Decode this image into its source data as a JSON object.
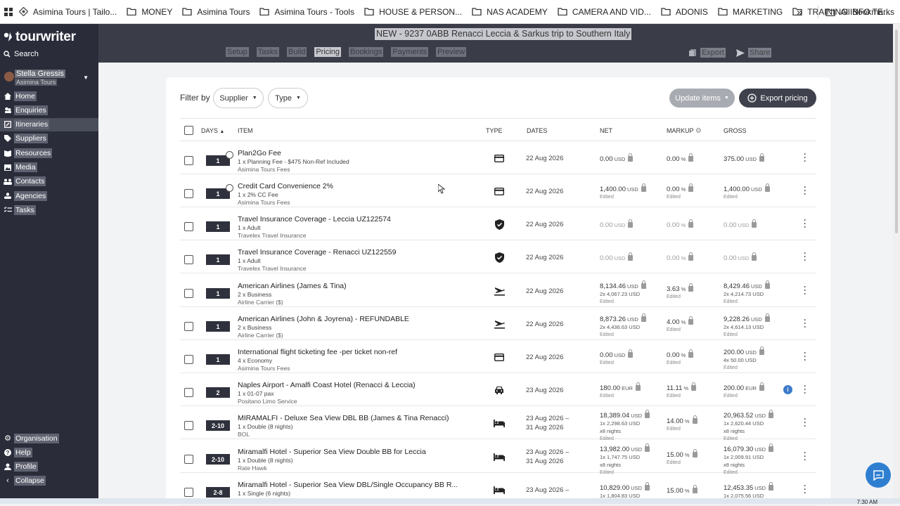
{
  "bookmarks": {
    "items": [
      "Asimina Tours | Tailo...",
      "MONEY",
      "Asimina Tours",
      "Asimina Tours - Tools",
      "HOUSE & PERSON...",
      "NAS ACADEMY",
      "CAMERA AND VID...",
      "ADONIS",
      "MARKETING",
      "TRAINING INFO TE..."
    ],
    "overflow": "»",
    "all": "All Bookmarks"
  },
  "sidebar": {
    "logo": "tourwriter",
    "search": "Search",
    "user_name": "Stella Gressis",
    "user_org": "Asimina Tours",
    "nav": [
      "Home",
      "Enquiries",
      "Itineraries",
      "Suppliers",
      "Resources",
      "Media",
      "Contacts",
      "Agencies",
      "Tasks"
    ],
    "bottom": [
      "Organisation",
      "Help",
      "Profile",
      "Collapse"
    ]
  },
  "header": {
    "title": "NEW - 9237 0ABB Renacci Leccia & Sarkus trip to Southern Italy",
    "tabs": [
      "Setup",
      "Tasks",
      "Build",
      "Pricing",
      "Bookings",
      "Payments",
      "Preview"
    ],
    "active_tab": "Pricing",
    "export": "Export",
    "share": "Share"
  },
  "toolbar": {
    "filter_by": "Filter by",
    "supplier": "Supplier",
    "type": "Type",
    "update_items": "Update items",
    "export_pricing": "Export pricing"
  },
  "columns": {
    "days": "DAYS",
    "item": "ITEM",
    "type": "TYPE",
    "dates": "DATES",
    "net": "NET",
    "markup": "MARKUP",
    "gross": "GROSS"
  },
  "rows": [
    {
      "days": "1",
      "title": "Plan2Go Fee",
      "sub": "1 x Planning Fee - $475 Non-Ref Included",
      "supplier": "Asimina Tours Fees",
      "type_icon": "card-icon",
      "date1": "22 Aug 2026",
      "date2": "",
      "net": "0.00",
      "net_cur": "USD",
      "net_line": "",
      "net_edited": "",
      "markup": "0.00",
      "markup_edited": "",
      "gross": "375.00",
      "gross_cur": "USD",
      "gross_line": "",
      "gross_edited": ""
    },
    {
      "days": "1",
      "title": "Credit Card Convenience 2%",
      "sub": "1 x 2% CC Fee",
      "supplier": "Asimina Tours Fees",
      "type_icon": "card-icon",
      "date1": "22 Aug 2026",
      "date2": "",
      "net": "1,400.00",
      "net_cur": "USD",
      "net_line": "",
      "net_edited": "Edited",
      "markup": "0.00",
      "markup_edited": "Edited",
      "gross": "1,400.00",
      "gross_cur": "USD",
      "gross_line": "",
      "gross_edited": "Edited"
    },
    {
      "days": "1",
      "title": "Travel Insurance Coverage - Leccia UZ122574",
      "sub": "1 x Adult",
      "supplier": "Travelex Travel Insurance",
      "type_icon": "shield-icon",
      "date1": "22 Aug 2026",
      "date2": "",
      "net": "0.00",
      "net_cur": "USD",
      "net_line": "",
      "net_edited": "",
      "markup": "0.00",
      "markup_edited": "",
      "gross": "0.00",
      "gross_cur": "USD",
      "gross_line": "",
      "gross_edited": ""
    },
    {
      "days": "1",
      "title": "Travel Insurance Coverage - Renacci UZ122559",
      "sub": "1 x Adult",
      "supplier": "Travelex Travel Insurance",
      "type_icon": "shield-icon",
      "date1": "22 Aug 2026",
      "date2": "",
      "net": "0.00",
      "net_cur": "USD",
      "net_line": "",
      "net_edited": "",
      "markup": "0.00",
      "markup_edited": "",
      "gross": "0.00",
      "gross_cur": "USD",
      "gross_line": "",
      "gross_edited": ""
    },
    {
      "days": "1",
      "title": "American Airlines (James & Tina)",
      "sub": "2 x Business",
      "supplier": "Airline Carrier ($)",
      "type_icon": "plane-icon",
      "date1": "22 Aug 2026",
      "date2": "",
      "net": "8,134.46",
      "net_cur": "USD",
      "net_line": "2x 4,067.23 USD",
      "net_edited": "Edited",
      "markup": "3.63",
      "markup_edited": "Edited",
      "gross": "8,429.46",
      "gross_cur": "USD",
      "gross_line": "2x 4,214.73 USD",
      "gross_edited": "Edited"
    },
    {
      "days": "1",
      "title": "American Airlines (John & Joyrena) - REFUNDABLE",
      "sub": "2 x Business",
      "supplier": "Airline Carrier ($)",
      "type_icon": "plane-icon",
      "date1": "22 Aug 2026",
      "date2": "",
      "net": "8,873.26",
      "net_cur": "USD",
      "net_line": "2x 4,436.63 USD",
      "net_edited": "Edited",
      "markup": "4.00",
      "markup_edited": "Edited",
      "gross": "9,228.26",
      "gross_cur": "USD",
      "gross_line": "2x 4,614.13 USD",
      "gross_edited": "Edited"
    },
    {
      "days": "1",
      "title": "International flight ticketing fee -per ticket non-ref",
      "sub": "4 x Economy",
      "supplier": "Asimina Tours Fees",
      "type_icon": "card-icon",
      "date1": "22 Aug 2026",
      "date2": "",
      "net": "0.00",
      "net_cur": "USD",
      "net_line": "",
      "net_edited": "Edited",
      "markup": "0.00",
      "markup_edited": "Edited",
      "gross": "200.00",
      "gross_cur": "USD",
      "gross_line": "4x 50.00 USD",
      "gross_edited": "Edited"
    },
    {
      "days": "2",
      "title": "Naples Airport - Amalfi Coast Hotel (Renacci & Leccia)",
      "sub": "1 x 01-07 pax",
      "supplier": "Positano Limo Service",
      "type_icon": "car-icon",
      "date1": "23 Aug 2026",
      "date2": "",
      "net": "180.00",
      "net_cur": "EUR",
      "net_line": "",
      "net_edited": "Edited",
      "markup": "11.11",
      "markup_edited": "Edited",
      "gross": "200.00",
      "gross_cur": "EUR",
      "gross_line": "",
      "gross_edited": "Edited",
      "info": "i"
    },
    {
      "days": "2-10",
      "title": "MIRAMALFI - Deluxe Sea View DBL BB (James & Tina Renacci)",
      "sub": "1 x Double (8 nights)",
      "supplier": "BOL",
      "type_icon": "bed-icon",
      "date1": "23 Aug 2026 –",
      "date2": "31 Aug 2026",
      "net": "18,389.04",
      "net_cur": "USD",
      "net_line": "1x 2,298.63 USD",
      "net_line2": "x8 nights",
      "net_edited": "Edited",
      "markup": "14.00",
      "markup_edited": "Edited",
      "gross": "20,963.52",
      "gross_cur": "USD",
      "gross_line": "1x 2,620.44 USD",
      "gross_line2": "x8 nights",
      "gross_edited": "Edited"
    },
    {
      "days": "2-10",
      "title": "Miramalfi Hotel - Superior Sea View Double BB for Leccia",
      "sub": "1 x Double (8 nights)",
      "supplier": "Rate Hawk",
      "type_icon": "bed-icon",
      "date1": "23 Aug 2026 –",
      "date2": "31 Aug 2026",
      "net": "13,982.00",
      "net_cur": "USD",
      "net_line": "1x 1,747.75 USD",
      "net_line2": "x8 nights",
      "net_edited": "Edited",
      "markup": "15.00",
      "markup_edited": "Edited",
      "gross": "16,079.30",
      "gross_cur": "USD",
      "gross_line": "1x 2,009.91 USD",
      "gross_line2": "x8 nights",
      "gross_edited": "Edited"
    },
    {
      "days": "2-8",
      "title": "Miramalfi Hotel - Superior Sea View DBL/Single Occupancy BB R...",
      "sub": "1 x Single (6 nights)",
      "supplier": "",
      "type_icon": "bed-icon",
      "date1": "23 Aug 2026 –",
      "date2": "",
      "net": "10,829.00",
      "net_cur": "USD",
      "net_line": "1x 1,804.83 USD",
      "net_line2": "",
      "net_edited": "",
      "markup": "15.00",
      "markup_edited": "",
      "gross": "12,453.35",
      "gross_cur": "USD",
      "gross_line": "1x 2,075.56 USD",
      "gross_line2": "",
      "gross_edited": ""
    }
  ],
  "clock": "7:30 AM",
  "colors": {
    "sidebar": "#2a2c3a",
    "header": "#3a3c48",
    "accent": "#2f7fd1"
  }
}
